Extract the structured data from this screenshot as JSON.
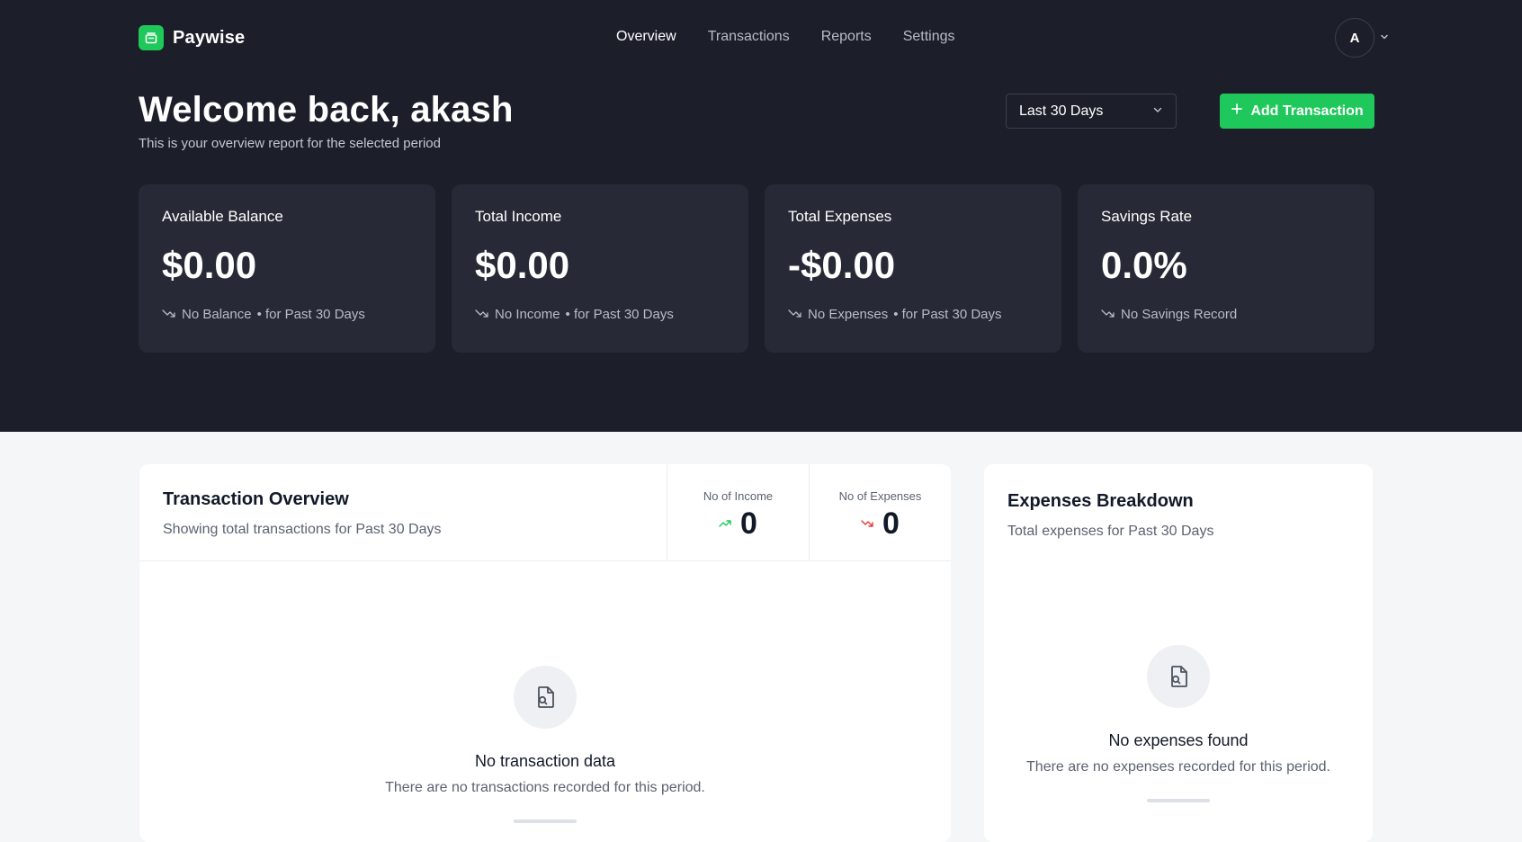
{
  "app": {
    "name": "Paywise"
  },
  "nav": {
    "items": [
      {
        "label": "Overview",
        "active": true
      },
      {
        "label": "Transactions",
        "active": false
      },
      {
        "label": "Reports",
        "active": false
      },
      {
        "label": "Settings",
        "active": false
      }
    ]
  },
  "user": {
    "initial": "A"
  },
  "welcome": {
    "title": "Welcome back, akash",
    "subtitle": "This is your overview report for the selected period"
  },
  "period_select": {
    "value": "Last 30 Days"
  },
  "add_button": {
    "label": "Add Transaction"
  },
  "stats": [
    {
      "label": "Available Balance",
      "value": "$0.00",
      "note": "No Balance",
      "period": "• for Past 30 Days"
    },
    {
      "label": "Total Income",
      "value": "$0.00",
      "note": "No Income",
      "period": "• for Past 30 Days"
    },
    {
      "label": "Total Expenses",
      "value": "-$0.00",
      "note": "No Expenses",
      "period": "• for Past 30 Days"
    },
    {
      "label": "Savings Rate",
      "value": "0.0%",
      "note": "No Savings Record",
      "period": ""
    }
  ],
  "transaction_overview": {
    "title": "Transaction Overview",
    "subtitle": "Showing total transactions for Past 30 Days",
    "income_label": "No of Income",
    "income_count": "0",
    "expense_label": "No of Expenses",
    "expense_count": "0",
    "empty_title": "No transaction data",
    "empty_subtitle": "There are no transactions recorded for this period."
  },
  "expenses_breakdown": {
    "title": "Expenses Breakdown",
    "subtitle": "Total expenses for Past 30 Days",
    "empty_title": "No expenses found",
    "empty_subtitle": "There are no expenses recorded for this period."
  },
  "colors": {
    "hero_bg": "#1c1f2a",
    "card_bg": "#272a36",
    "accent_green": "#1ec85a",
    "up_trend": "#1ec85a",
    "down_trend": "#e53935"
  }
}
